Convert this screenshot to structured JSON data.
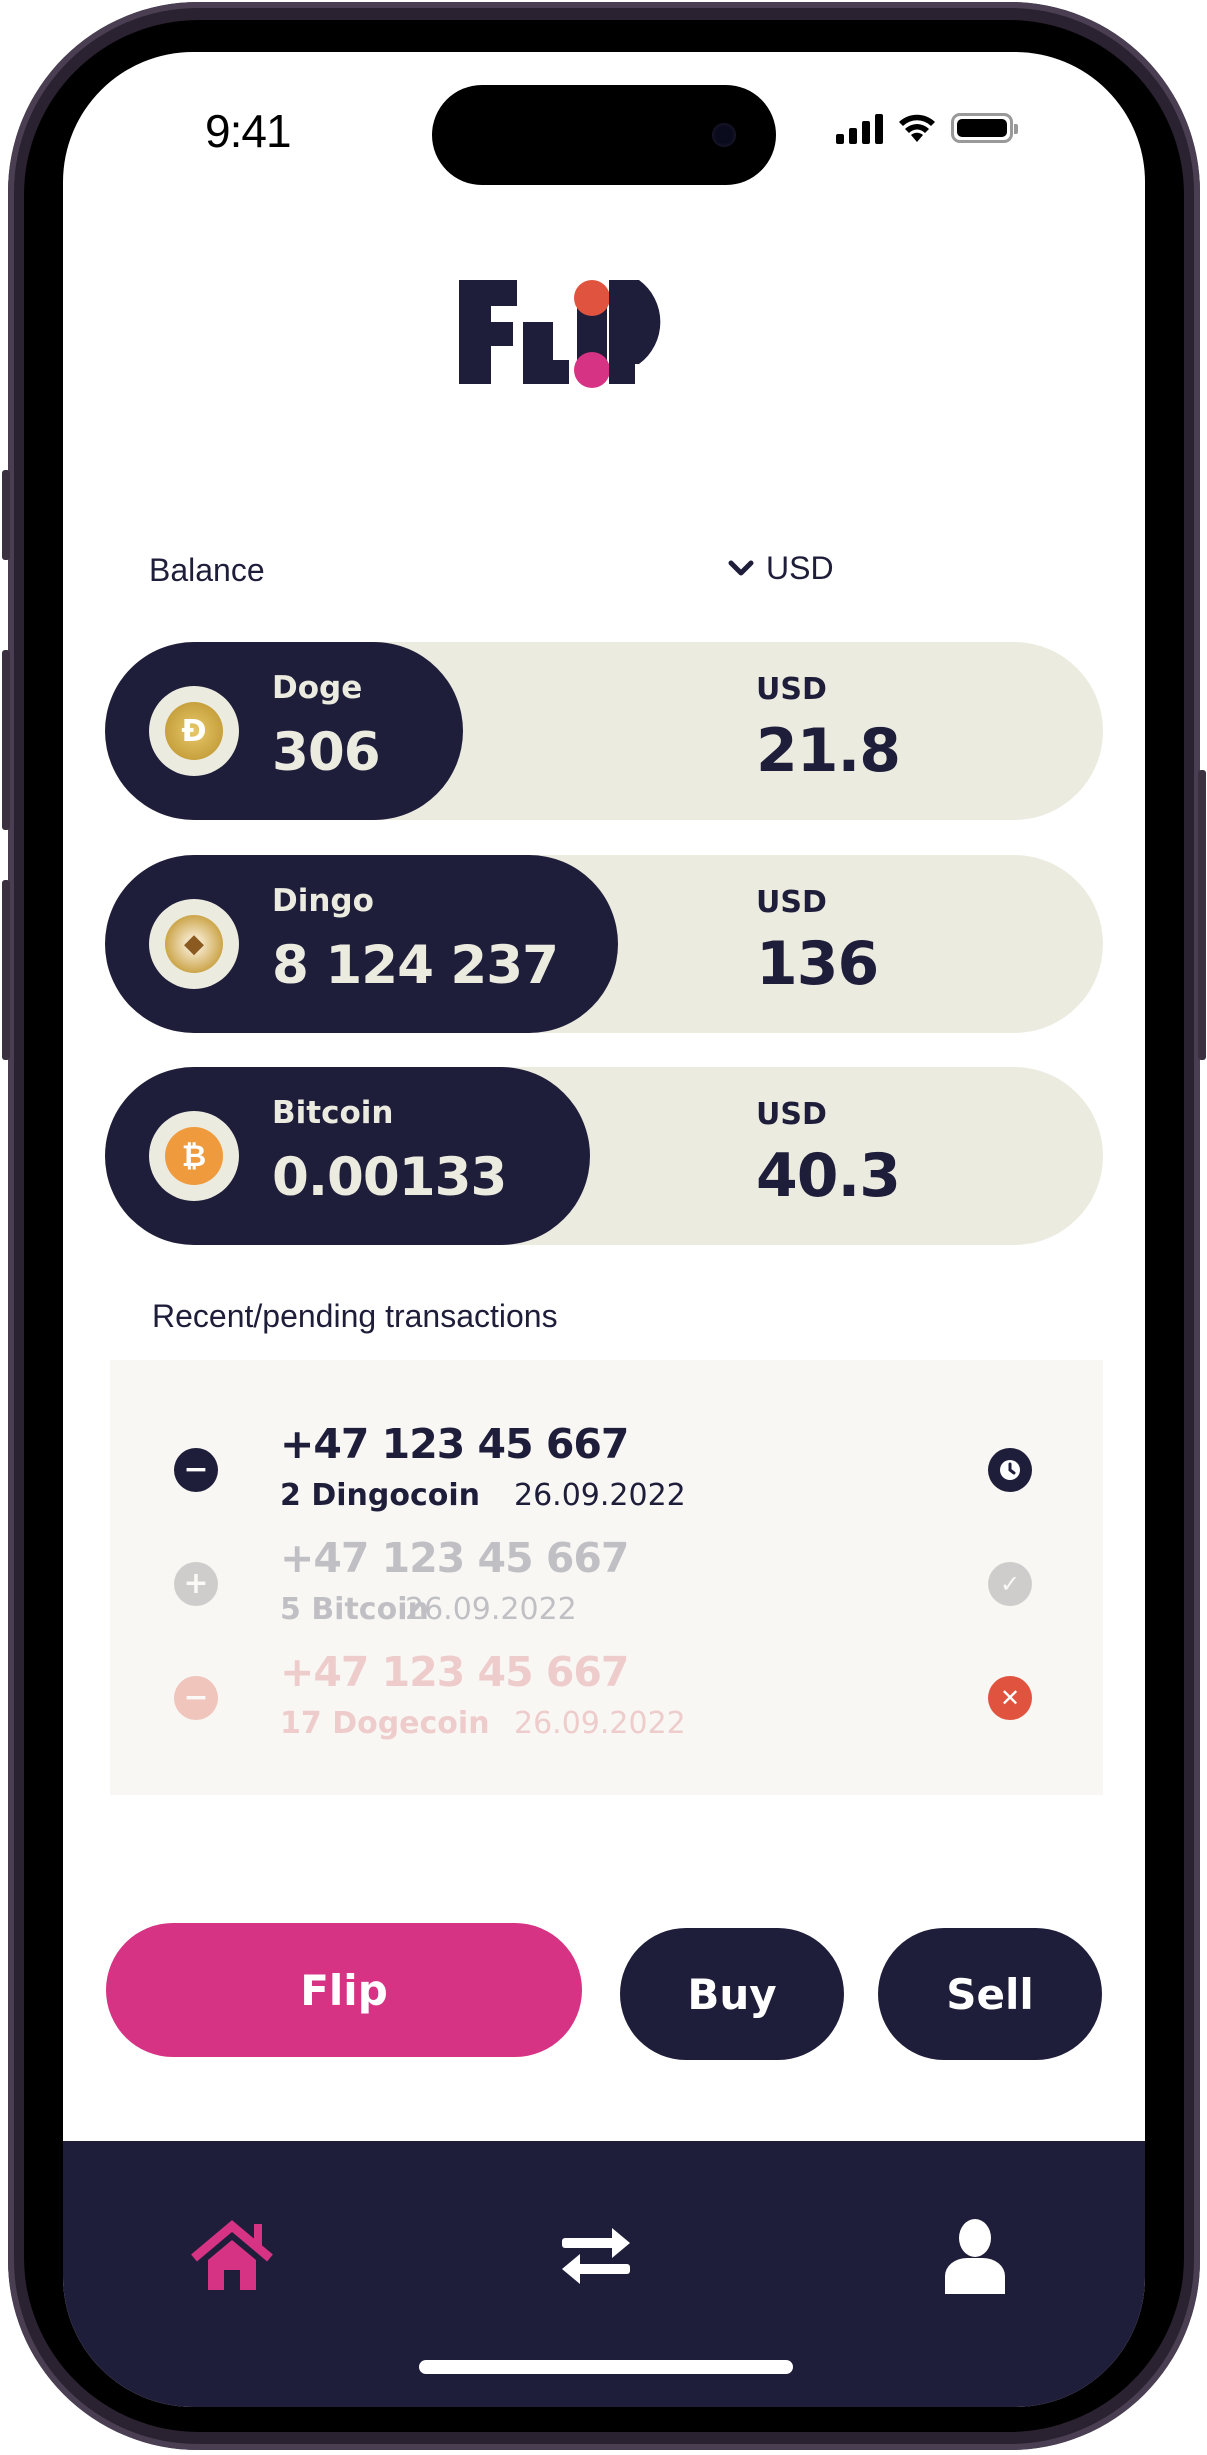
{
  "status_bar": {
    "time": "9:41",
    "icons": [
      "signal-icon",
      "wifi-icon",
      "battery-icon"
    ]
  },
  "app": {
    "logo_text": "FLIP",
    "brand_colors": {
      "navy": "#1f1e3a",
      "pink": "#d63384",
      "coral": "#e0533f",
      "cream": "#ecebe0"
    }
  },
  "balance": {
    "label": "Balance",
    "currency_selector": {
      "selected": "USD",
      "icon": "chevron-down-icon"
    },
    "cards": [
      {
        "coin": "Doge",
        "amount": "306",
        "fiat_label": "USD",
        "fiat_value": "21.8",
        "icon": "dogecoin-icon",
        "coin_color": "#c9a33a",
        "dark_share": 0.36
      },
      {
        "coin": "Dingo",
        "amount": "8 124 237",
        "fiat_label": "USD",
        "fiat_value": "136",
        "icon": "dingocoin-icon",
        "coin_color": "#c8a040",
        "dark_share": 0.51
      },
      {
        "coin": "Bitcoin",
        "amount": "0.00133",
        "fiat_label": "USD",
        "fiat_value": "40.3",
        "icon": "bitcoin-icon",
        "coin_color": "#f09a3e",
        "dark_share": 0.49
      }
    ]
  },
  "transactions": {
    "title": "Recent/pending transactions",
    "rows": [
      {
        "direction": "outgoing",
        "direction_icon": "minus-icon",
        "phone": "+47 123 45 667",
        "coin": "2 Dingocoin",
        "date": "26.09.2022",
        "status": "pending",
        "status_icon": "clock-icon"
      },
      {
        "direction": "incoming",
        "direction_icon": "plus-icon",
        "phone": "+47 123 45 667",
        "coin": "5 Bitcoin",
        "date": "26.09.2022",
        "status": "completed",
        "status_icon": "check-icon"
      },
      {
        "direction": "outgoing",
        "direction_icon": "minus-icon",
        "phone": "+47 123 45 667",
        "coin": "17 Dogecoin",
        "date": "26.09.2022",
        "status": "failed",
        "status_icon": "close-icon"
      }
    ]
  },
  "actions": {
    "flip": "Flip",
    "buy": "Buy",
    "sell": "Sell"
  },
  "nav": {
    "items": [
      {
        "name": "home",
        "icon": "home-icon",
        "active": true
      },
      {
        "name": "transfer",
        "icon": "swap-arrows-icon",
        "active": false
      },
      {
        "name": "profile",
        "icon": "user-icon",
        "active": false
      }
    ]
  }
}
